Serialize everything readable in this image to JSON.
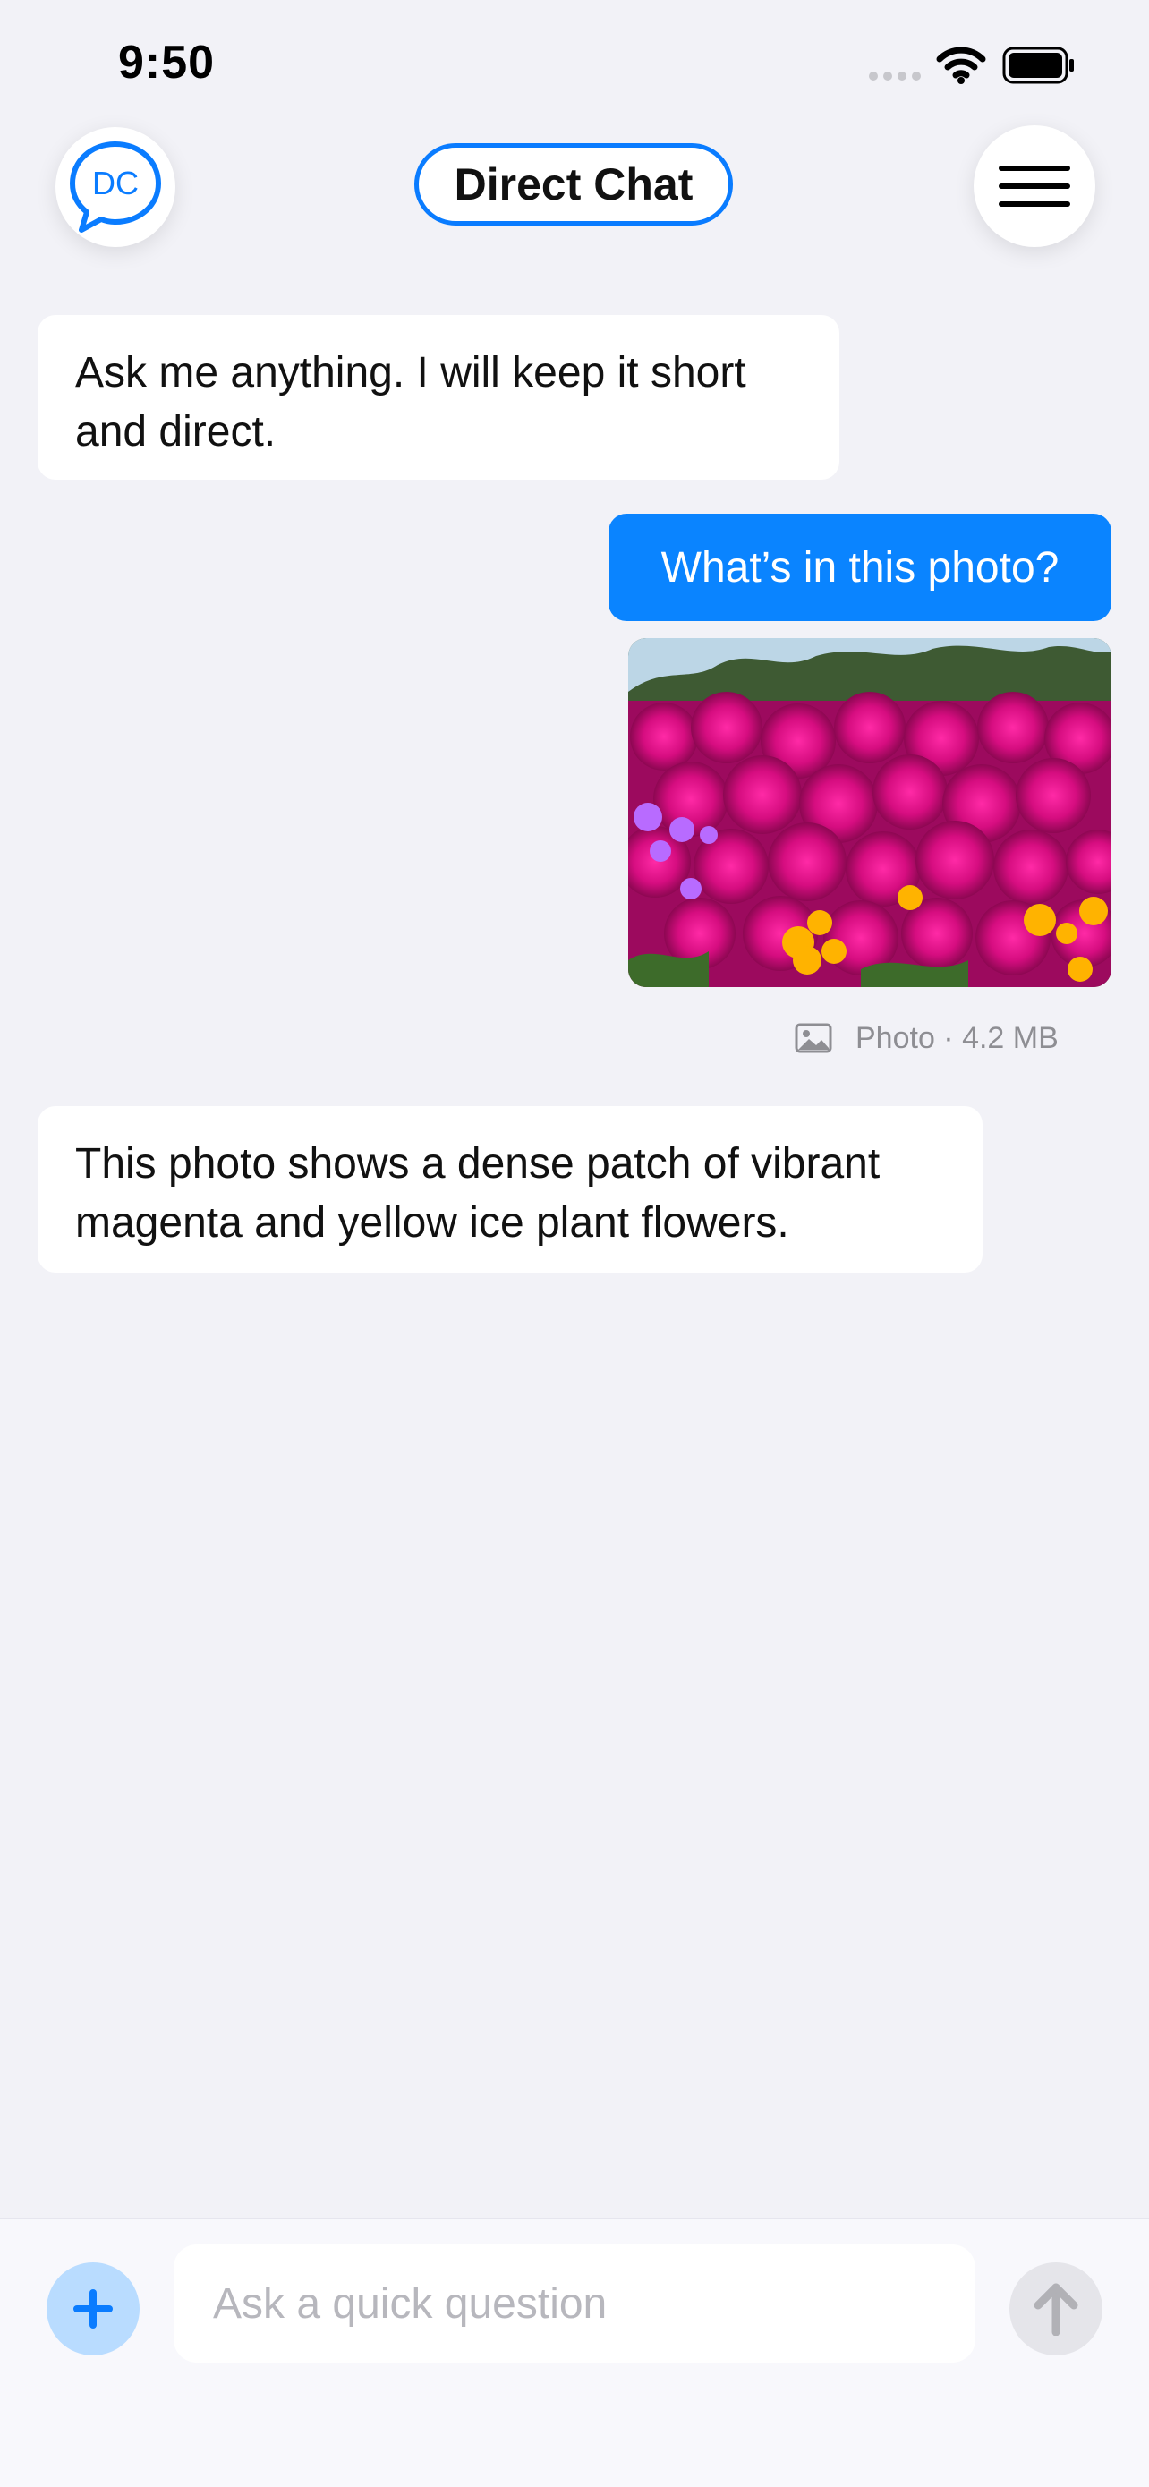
{
  "status_bar": {
    "time": "9:50",
    "icons": [
      "cellular-signal-icon",
      "wifi-icon",
      "battery-icon"
    ]
  },
  "header": {
    "logo_text": "DC",
    "title": "Direct Chat",
    "menu_icon": "hamburger-menu-icon"
  },
  "messages": [
    {
      "role": "assistant",
      "text": "Ask me anything. I will keep it short and direct."
    },
    {
      "role": "user",
      "text": "What’s in this photo?"
    },
    {
      "role": "user",
      "type": "image",
      "meta": "Photo · 4.2 MB",
      "meta_icon": "photo-icon"
    },
    {
      "role": "assistant",
      "text": "This photo shows a dense patch of vibrant magenta and yellow ice plant flowers."
    }
  ],
  "composer": {
    "placeholder": "Ask a quick question",
    "value": "",
    "add_icon": "plus-icon",
    "send_icon": "arrow-up-icon"
  },
  "colors": {
    "accent": "#0a84ff",
    "background": "#f2f2f7",
    "bubble_in": "#ffffff",
    "muted_text": "#8e8e93"
  }
}
